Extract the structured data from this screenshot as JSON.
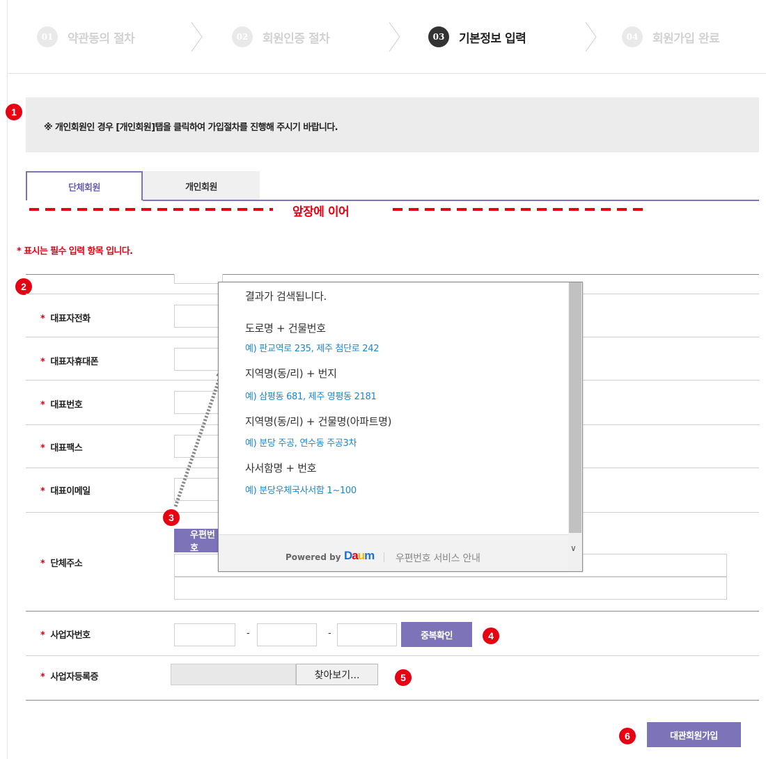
{
  "steps": [
    {
      "num": "01",
      "label": "약관동의 절차",
      "state": "inactive"
    },
    {
      "num": "02",
      "label": "회원인증 절차",
      "state": "inactive"
    },
    {
      "num": "03",
      "label": "기본정보 입력",
      "state": "active"
    },
    {
      "num": "04",
      "label": "회원가입 완료",
      "state": "inactive"
    }
  ],
  "notice": "※ 개인회원인 경우 [개인회원]탭을 클릭하여 가입절차를 진행해 주시기 바랍니다.",
  "badges": [
    "1",
    "2",
    "3",
    "4",
    "5",
    "6"
  ],
  "tabs": [
    {
      "label": "단체회원",
      "selected": true
    },
    {
      "label": "개인회원",
      "selected": false
    }
  ],
  "continue_label": "앞장에 이어",
  "required_note": "* 표시는 필수 입력 항목 입니다.",
  "required_mark": "*",
  "fields": {
    "rep_phone": "대표자전화",
    "rep_mobile": "대표자휴대폰",
    "main_number": "대표번호",
    "main_fax": "대표팩스",
    "main_email": "대표이메일",
    "org_address": "단체주소",
    "biz_number": "사업자번호",
    "biz_cert": "사업자등록증"
  },
  "biz_number_sep": "-",
  "buttons": {
    "postcode": "우편번호",
    "dup_check": "중복확인",
    "browse": "찾아보기...",
    "submit": "대관회원가입"
  },
  "popup": {
    "intro": "결과가 검색됩니다.",
    "items": [
      {
        "title": "도로명 + 건물번호",
        "example": "예) 판교역로 235,  제주 첨단로 242"
      },
      {
        "title": "지역명(동/리) + 번지",
        "example": "예) 삼평동 681,  제주 영평동 2181"
      },
      {
        "title": "지역명(동/리) + 건물명(아파트명)",
        "example": "예) 분당 주공,  연수동 주공3차"
      },
      {
        "title": "사서함명 + 번호",
        "example": "예) 분당우체국사서함 1~100"
      }
    ],
    "powered_by": "Powered by",
    "brand": "Daum",
    "service_info": "우편번호 서비스 안내"
  },
  "colors": {
    "accent": "#7c73b9",
    "required": "#e60012",
    "badge": "#e60012",
    "example_link": "#1a87c9"
  }
}
